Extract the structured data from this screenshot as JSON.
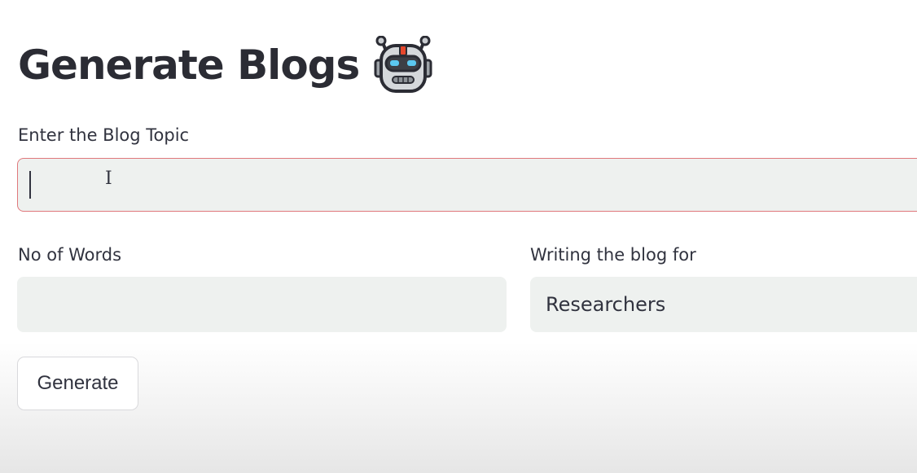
{
  "header": {
    "title": "Generate Blogs",
    "icon": "robot-icon"
  },
  "form": {
    "topic": {
      "label": "Enter the Blog Topic",
      "value": ""
    },
    "words": {
      "label": "No of Words",
      "value": ""
    },
    "audience": {
      "label": "Writing the blog for",
      "selected": "Researchers"
    },
    "submit_label": "Generate"
  },
  "colors": {
    "input_background": "#eef1ef",
    "focus_border": "#e0787c",
    "text": "#31333f"
  }
}
